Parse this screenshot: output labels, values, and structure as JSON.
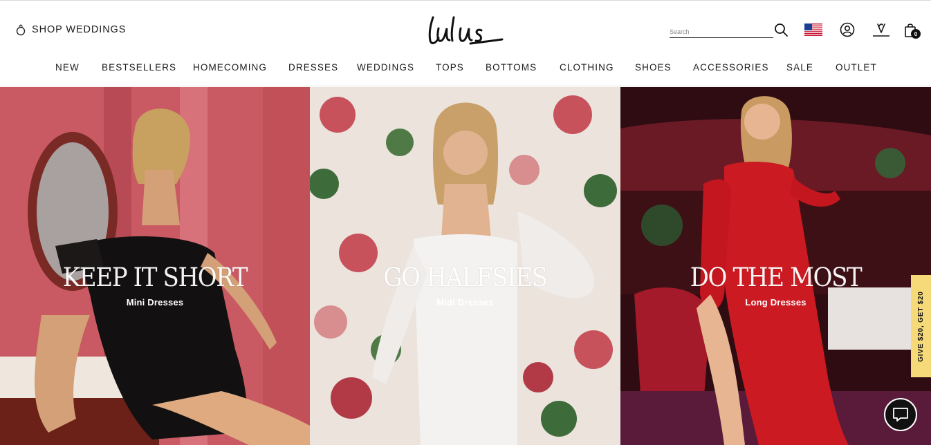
{
  "header": {
    "shop_weddings_label": "SHOP WEDDINGS",
    "logo_text": "Lulus",
    "search_placeholder": "Search",
    "bag_count": "0",
    "icons": [
      "ring-icon",
      "search-icon",
      "us-flag-icon",
      "account-icon",
      "wishlist-icon",
      "shopping-bag-icon"
    ]
  },
  "nav": {
    "items": [
      {
        "label": "NEW"
      },
      {
        "label": "BESTSELLERS"
      },
      {
        "label": "HOMECOMING"
      },
      {
        "label": "DRESSES"
      },
      {
        "label": "WEDDINGS"
      },
      {
        "label": "TOPS"
      },
      {
        "label": "BOTTOMS"
      },
      {
        "label": "CLOTHING"
      },
      {
        "label": "SHOES"
      },
      {
        "label": "ACCESSORIES"
      },
      {
        "label": "SALE"
      },
      {
        "label": "OUTLET"
      }
    ]
  },
  "hero": {
    "panels": [
      {
        "headline": "KEEP IT SHORT",
        "subtitle": "Mini Dresses"
      },
      {
        "headline": "GO HALFSIES",
        "subtitle": "Midi Dresses"
      },
      {
        "headline": "DO THE MOST",
        "subtitle": "Long Dresses"
      }
    ]
  },
  "promo_tab": {
    "label": "GIVE $20, GET $20"
  },
  "colors": {
    "promo_bg": "#f6d978",
    "chat_bg": "#111111",
    "text": "#1a1a1a"
  }
}
